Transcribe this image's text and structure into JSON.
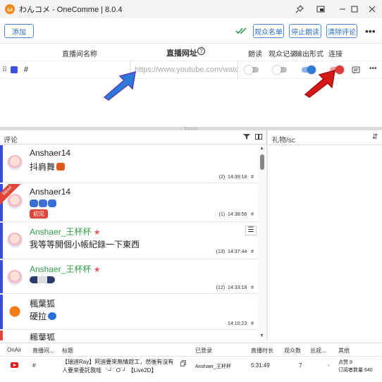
{
  "window": {
    "title": "わんコメ - OneComme | 8.0.4",
    "controls": [
      "pin-icon",
      "picture-in-picture-icon",
      "minimize-icon",
      "maximize-icon",
      "close-icon"
    ]
  },
  "toolbar": {
    "add_label": "添加",
    "viewer_list_label": "观众名单",
    "stop_reading_label": "停止朗读",
    "clear_comments_label": "清除评论"
  },
  "stream_table": {
    "headers": {
      "name": "直播间名称",
      "url": "直播网址",
      "read": "朗读",
      "viewer_record": "观众记录",
      "output_format": "输出形式",
      "connect": "连接"
    },
    "row": {
      "color": "#3b4fe0",
      "name_value": "#",
      "url_placeholder": "https://www.youtube.com/watch?v=",
      "read_on": false,
      "viewer_record_on": false,
      "output_on": true,
      "connect_on": true
    },
    "accent": "#2f7ad9",
    "connect_color": "#e03a3a"
  },
  "comments": {
    "header": "评论",
    "items": [
      {
        "name": "Anshaer14",
        "message": "抖肩舞",
        "count": "(2)",
        "time": "14:39:18",
        "hash": "#",
        "member": false,
        "new": false,
        "badge": ""
      },
      {
        "name": "Anshaer14",
        "message": "",
        "count": "(1)",
        "time": "14:38:56",
        "hash": "#",
        "member": false,
        "new": true,
        "new_label": "New!",
        "badge": "初见"
      },
      {
        "name": "Anshaer_王杯杯",
        "message": "我等等開個小帳紀錄一下東西",
        "count": "(13)",
        "time": "14:37:44",
        "hash": "#",
        "member": true,
        "new": false,
        "badge": ""
      },
      {
        "name": "Anshaer_王杯杯",
        "message": "",
        "count": "(12)",
        "time": "14:33:18",
        "hash": "#",
        "member": true,
        "new": false,
        "badge": ""
      },
      {
        "name": "楓葉狐",
        "message": "硬拉",
        "count": "",
        "time": "14:10:23",
        "hash": "#",
        "member": false,
        "new": false,
        "badge": ""
      },
      {
        "name": "楓葉狐",
        "message": "",
        "count": "",
        "time": "",
        "hash": "",
        "member": false,
        "new": false,
        "badge": ""
      }
    ]
  },
  "gifts": {
    "header": "礼物/sc"
  },
  "bottom_table": {
    "headers": {
      "onair": "OnAir",
      "room": "直播间...",
      "title": "标题",
      "logged_in": "已登录",
      "duration": "直播时长",
      "viewers": "观众数",
      "total_viewers": "总观...",
      "other": "其他"
    },
    "row": {
      "room": "#",
      "title": "【瑞迪Ray】阿迪要來無情趕工，然後有沒有人要來委託我哇 ╰┘` O´┘ 【Live2D】",
      "logged_in": "Anshaer_王杯杯",
      "duration": "5:31:49",
      "viewers": "7",
      "total_viewers": "-",
      "likes": "点赞 9",
      "subscribers": "订阅者数量 640"
    }
  }
}
